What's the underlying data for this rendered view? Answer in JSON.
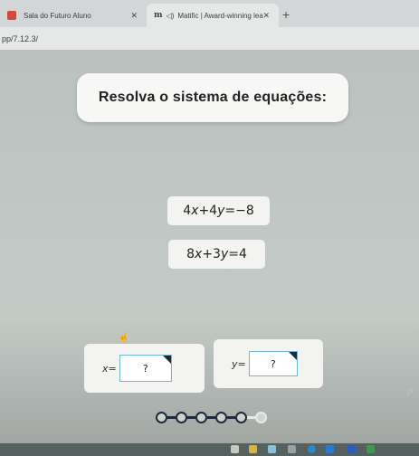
{
  "browser": {
    "tabs": [
      {
        "title": "Sala do Futuro Aluno",
        "close": "✕"
      },
      {
        "title": "Matific | Award-winning lea",
        "close": "✕"
      }
    ],
    "new_tab": "+",
    "address": "pp/7.12.3/"
  },
  "question": {
    "title": "Resolva o sistema de equações:"
  },
  "equations": [
    {
      "coef_x": "4",
      "var_x": "x",
      "op": "+4",
      "var_y": "y",
      "rhs": "=−8"
    },
    {
      "coef_x": "8",
      "var_x": "x",
      "op": "+3",
      "var_y": "y",
      "rhs": "=4"
    }
  ],
  "answers": {
    "x": {
      "var": "x",
      "eq": "=",
      "value": "?"
    },
    "y": {
      "var": "y",
      "eq": "=",
      "value": "?"
    }
  },
  "partial_text": "P",
  "progress": {
    "total_steps": 6,
    "completed_steps": 4
  },
  "colors": {
    "input_border": "#6fb7d2",
    "progress_done": "#1f2a3a",
    "favicon_red": "#d44a3a"
  }
}
